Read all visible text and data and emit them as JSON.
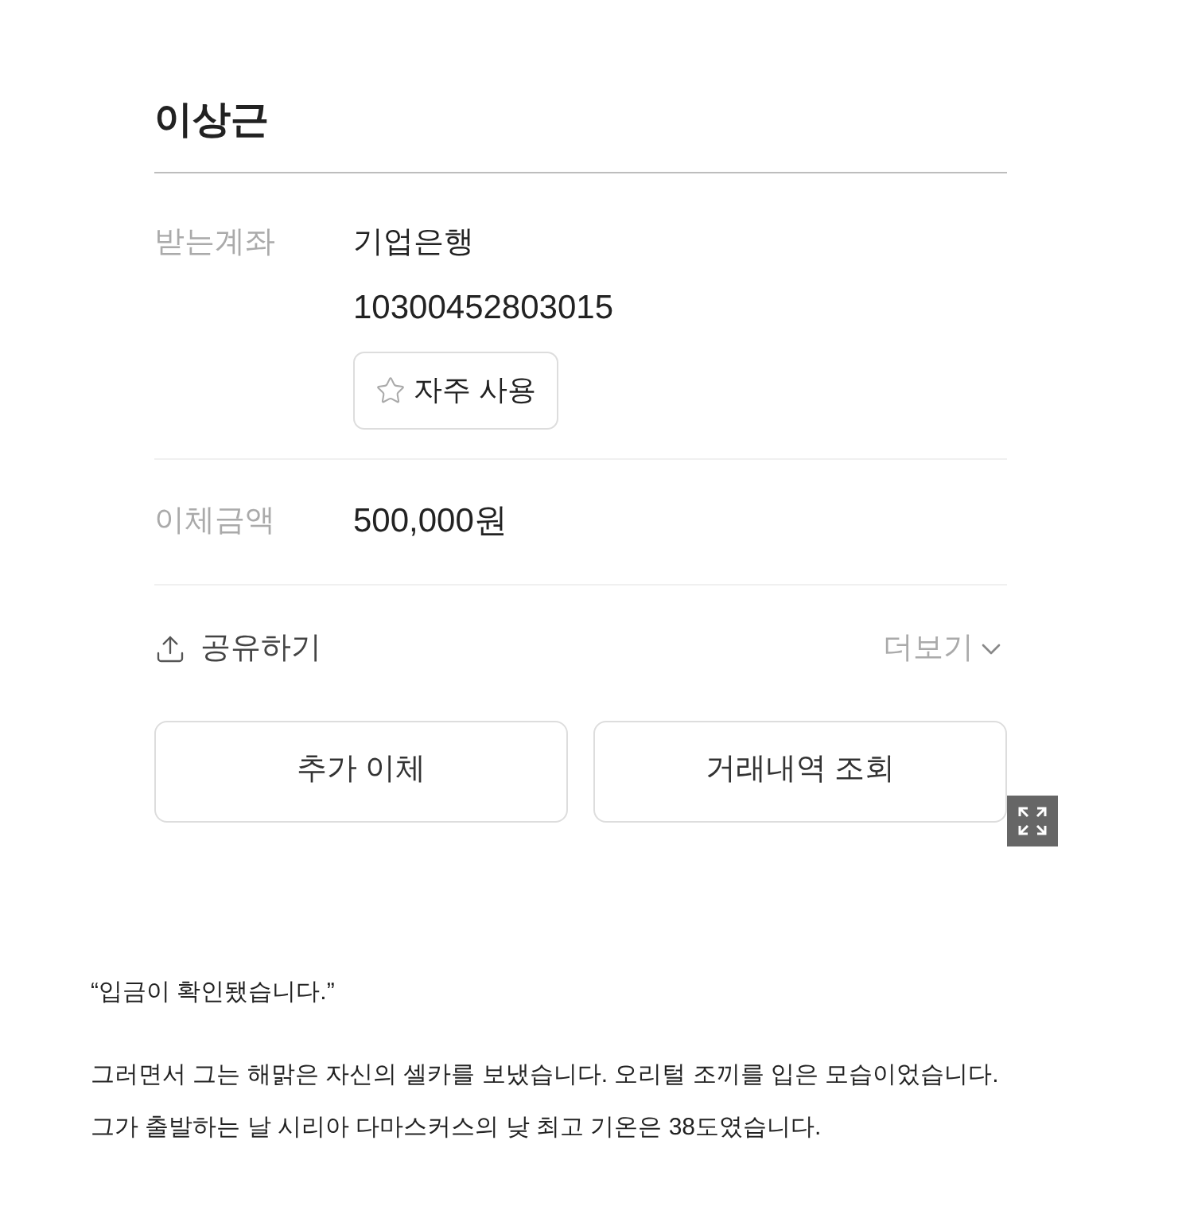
{
  "recipient": {
    "name": "이상근"
  },
  "account": {
    "label": "받는계좌",
    "bank": "기업은행",
    "number": "10300452803015",
    "favorite_button": "자주 사용"
  },
  "amount": {
    "label": "이체금액",
    "value": "500,000원"
  },
  "share": {
    "label": "공유하기"
  },
  "more": {
    "label": "더보기"
  },
  "buttons": [
    "추가 이체",
    "거래내역 조회"
  ],
  "article": {
    "quote": "“입금이 확인됐습니다.”",
    "lines": [
      "그러면서 그는 해맑은 자신의 셀카를 보냈습니다. 오리털 조끼를 입은 모습이었습니다.",
      "그가 출발하는 날 시리아 다마스커스의 낮 최고 기온은 38도였습니다."
    ]
  }
}
